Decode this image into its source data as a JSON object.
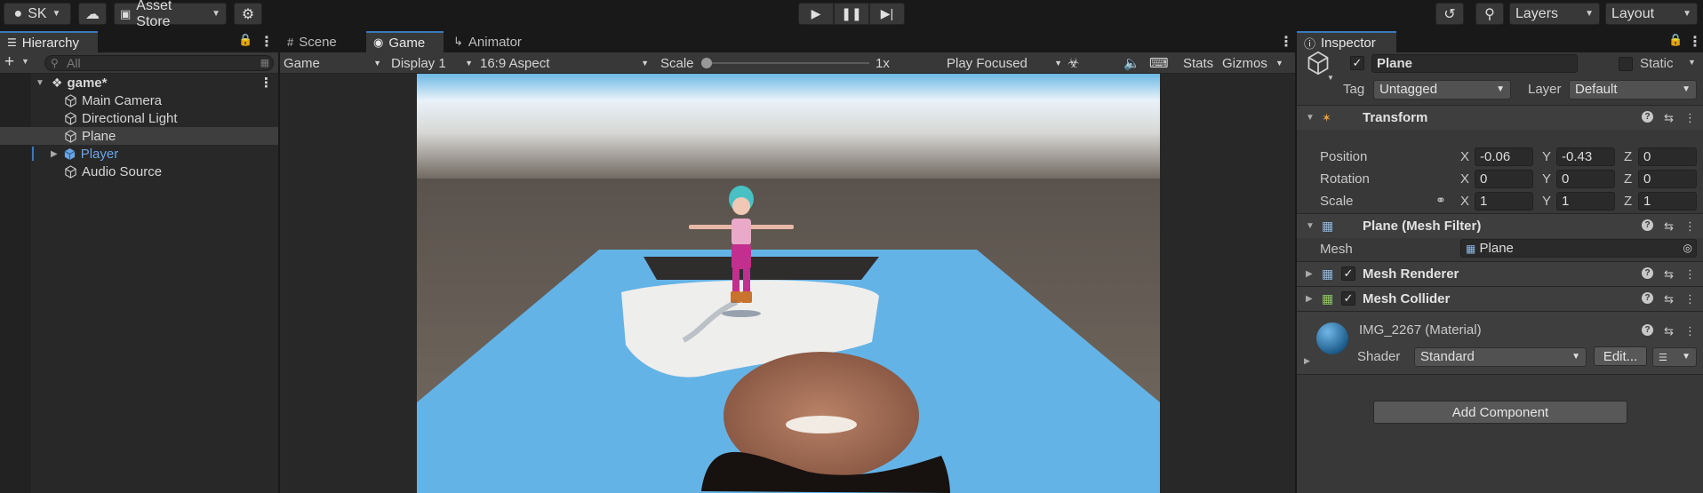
{
  "toolbar": {
    "account": "SK",
    "asset_store": "Asset Store",
    "layers": "Layers",
    "layout": "Layout"
  },
  "hierarchy": {
    "tab": "Hierarchy",
    "search_placeholder": "All",
    "scene": "game*",
    "items": [
      "Main Camera",
      "Directional Light",
      "Plane",
      "Player",
      "Audio Source"
    ]
  },
  "game": {
    "tabs": [
      "Scene",
      "Game",
      "Animator"
    ],
    "display_mode": "Game",
    "display": "Display 1",
    "aspect": "16:9 Aspect",
    "scale_label": "Scale",
    "scale_value": "1x",
    "play_mode": "Play Focused",
    "stats": "Stats",
    "gizmos": "Gizmos"
  },
  "inspector": {
    "tab": "Inspector",
    "object_name": "Plane",
    "static_label": "Static",
    "tag_label": "Tag",
    "tag_value": "Untagged",
    "layer_label": "Layer",
    "layer_value": "Default",
    "transform": {
      "title": "Transform",
      "position_label": "Position",
      "rotation_label": "Rotation",
      "scale_label": "Scale",
      "position": [
        "-0.06",
        "-0.43",
        "0"
      ],
      "rotation": [
        "0",
        "0",
        "0"
      ],
      "scale": [
        "1",
        "1",
        "1"
      ],
      "axes": [
        "X",
        "Y",
        "Z"
      ]
    },
    "mesh_filter": {
      "title": "Plane (Mesh Filter)",
      "mesh_label": "Mesh",
      "mesh_value": "Plane"
    },
    "mesh_renderer": "Mesh Renderer",
    "mesh_collider": "Mesh Collider",
    "material": {
      "name": "IMG_2267",
      "kind": "(Material)",
      "shader_label": "Shader",
      "shader_value": "Standard",
      "edit_button": "Edit..."
    },
    "add_component": "Add Component"
  },
  "colors": {
    "accent": "#3a79bb",
    "player_blue": "#6aa5e6",
    "sky_top": "#e8f1f7",
    "ground": "#6b625a",
    "plane": "#64b3e6"
  }
}
